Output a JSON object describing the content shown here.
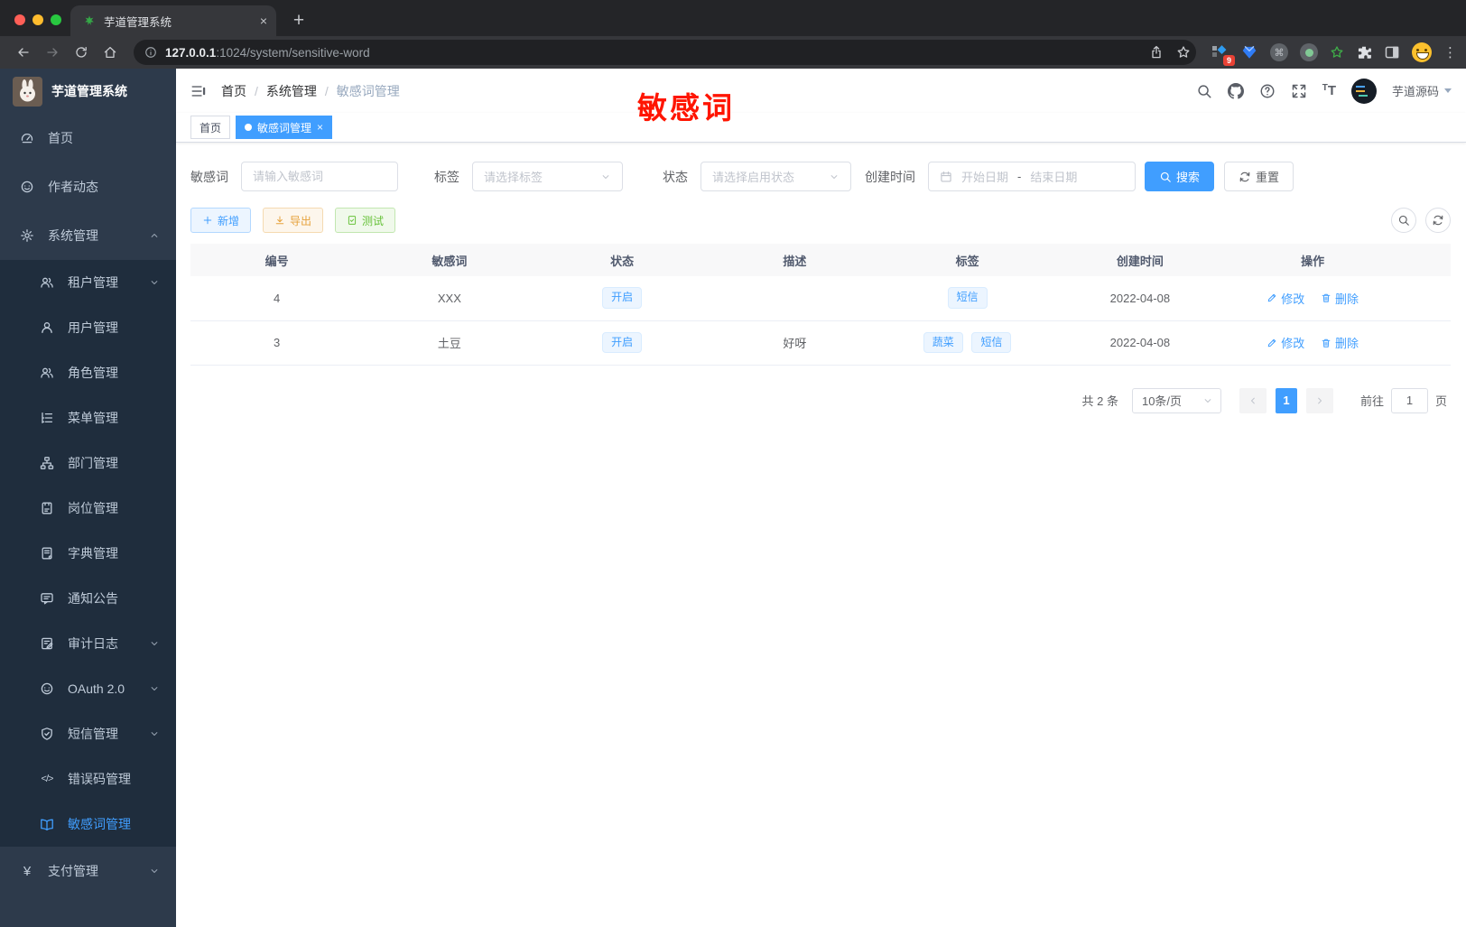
{
  "browser": {
    "tab_title": "芋道管理系统",
    "url_host": "127.0.0.1",
    "url_path": ":1024/system/sensitive-word",
    "ext_badge": "9"
  },
  "annotation": {
    "text": "敏感词"
  },
  "sidebar": {
    "title": "芋道管理系统",
    "items": [
      {
        "label": "首页"
      },
      {
        "label": "作者动态"
      },
      {
        "label": "系统管理"
      },
      {
        "label": "租户管理"
      },
      {
        "label": "用户管理"
      },
      {
        "label": "角色管理"
      },
      {
        "label": "菜单管理"
      },
      {
        "label": "部门管理"
      },
      {
        "label": "岗位管理"
      },
      {
        "label": "字典管理"
      },
      {
        "label": "通知公告"
      },
      {
        "label": "审计日志"
      },
      {
        "label": "OAuth 2.0"
      },
      {
        "label": "短信管理"
      },
      {
        "label": "错误码管理"
      },
      {
        "label": "敏感词管理"
      },
      {
        "label": "支付管理"
      }
    ]
  },
  "header": {
    "breadcrumb": [
      "首页",
      "系统管理",
      "敏感词管理"
    ],
    "username": "芋道源码"
  },
  "tagbar": {
    "tags": [
      {
        "label": "首页"
      },
      {
        "label": "敏感词管理"
      }
    ]
  },
  "filters": {
    "keyword_label": "敏感词",
    "keyword_placeholder": "请输入敏感词",
    "tag_label": "标签",
    "tag_placeholder": "请选择标签",
    "status_label": "状态",
    "status_placeholder": "请选择启用状态",
    "date_label": "创建时间",
    "date_start": "开始日期",
    "date_sep": "-",
    "date_end": "结束日期",
    "search": "搜索",
    "reset": "重置"
  },
  "toolbar": {
    "add": "新增",
    "export": "导出",
    "test": "测试"
  },
  "table": {
    "headers": [
      "编号",
      "敏感词",
      "状态",
      "描述",
      "标签",
      "创建时间",
      "操作"
    ],
    "rows": [
      {
        "id": "4",
        "word": "XXX",
        "status": "开启",
        "description": "",
        "tags": [
          "短信"
        ],
        "created": "2022-04-08",
        "edit": "修改",
        "delete": "删除"
      },
      {
        "id": "3",
        "word": "土豆",
        "status": "开启",
        "description": "好呀",
        "tags": [
          "蔬菜",
          "短信"
        ],
        "created": "2022-04-08",
        "edit": "修改",
        "delete": "删除"
      }
    ]
  },
  "pagination": {
    "total": "共 2 条",
    "page_size": "10条/页",
    "page": "1",
    "goto_label": "前往",
    "goto_value": "1",
    "unit": "页"
  },
  "colors": {
    "accent": "#409eff",
    "warning": "#e6a23c",
    "success": "#67c23a",
    "annotation_red": "#ff1500",
    "sidebar_bg": "#2d3a4b",
    "submenu_bg": "#1f2d3d"
  }
}
